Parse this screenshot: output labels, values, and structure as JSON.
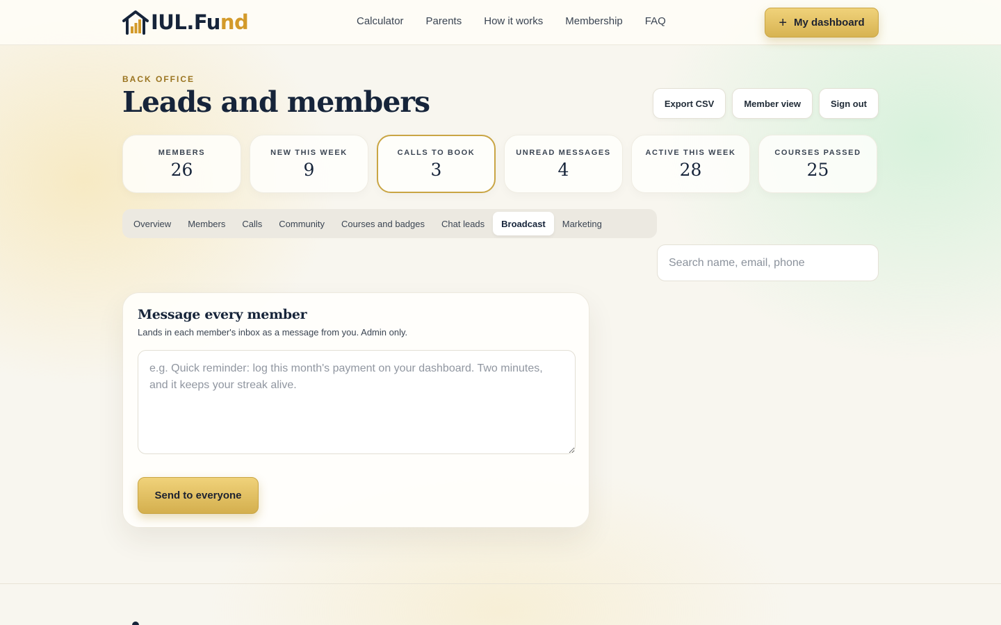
{
  "brand": {
    "name_main": "IUL.Fu",
    "name_accent": "nd",
    "logo_icon": "house-chart-icon"
  },
  "nav": {
    "items": [
      "Calculator",
      "Parents",
      "How it works",
      "Membership",
      "FAQ"
    ]
  },
  "header": {
    "dashboard_label": "My dashboard",
    "dashboard_icon": "plus-icon"
  },
  "page": {
    "eyebrow": "BACK OFFICE",
    "title": "Leads and members"
  },
  "actions": [
    "Export CSV",
    "Member view",
    "Sign out"
  ],
  "stats": [
    {
      "label": "MEMBERS",
      "value": "26"
    },
    {
      "label": "NEW THIS WEEK",
      "value": "9"
    },
    {
      "label": "CALLS TO BOOK",
      "value": "3",
      "highlighted": true
    },
    {
      "label": "UNREAD MESSAGES",
      "value": "4"
    },
    {
      "label": "ACTIVE THIS WEEK",
      "value": "28"
    },
    {
      "label": "COURSES PASSED",
      "value": "25"
    }
  ],
  "tabs": {
    "items": [
      "Overview",
      "Members",
      "Calls",
      "Community",
      "Courses and badges",
      "Chat leads",
      "Broadcast",
      "Marketing"
    ],
    "active": "Broadcast"
  },
  "search": {
    "placeholder": "Search name, email, phone",
    "value": ""
  },
  "broadcast": {
    "title": "Message every member",
    "subtitle": "Lands in each member's inbox as a message from you. Admin only.",
    "placeholder": "e.g. Quick reminder: log this month's payment on your dashboard. Two minutes, and it keeps your streak alive.",
    "value": "",
    "send_label": "Send to everyone"
  },
  "colors": {
    "accent_gold": "#d7b352",
    "navy": "#16243a",
    "logo_accent": "#d39a2a"
  }
}
